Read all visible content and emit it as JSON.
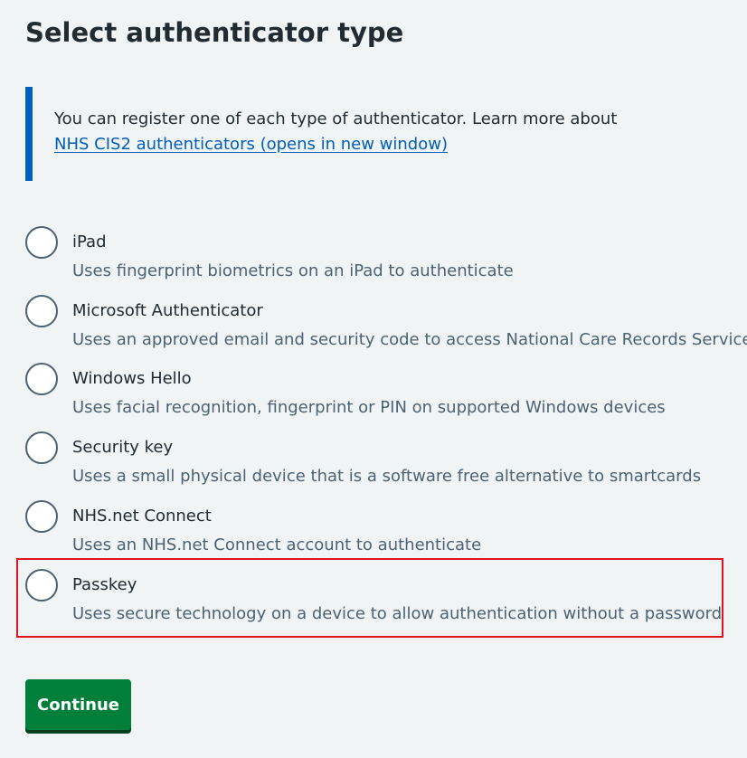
{
  "page": {
    "title": "Select authenticator type"
  },
  "inset": {
    "text": "You can register one of each type of authenticator. Learn more about",
    "link_text": "NHS CIS2 authenticators (opens in new window)"
  },
  "options": [
    {
      "label": "iPad",
      "hint": "Uses fingerprint biometrics on an iPad to authenticate"
    },
    {
      "label": "Microsoft Authenticator",
      "hint": "Uses an approved email and security code to access National Care Records Service"
    },
    {
      "label": "Windows Hello",
      "hint": "Uses facial recognition, fingerprint or PIN on supported Windows devices"
    },
    {
      "label": "Security key",
      "hint": "Uses a small physical device that is a software free alternative to smartcards"
    },
    {
      "label": "NHS.net Connect",
      "hint": "Uses an NHS.net Connect account to authenticate"
    },
    {
      "label": "Passkey",
      "hint": "Uses secure technology on a device to allow authentication without a password"
    }
  ],
  "actions": {
    "continue_label": "Continue"
  },
  "colors": {
    "background": "#f0f4f5",
    "inset_border": "#005eb8",
    "link": "#005eb8",
    "radio_border": "#4c6272",
    "hint_text": "#4c6272",
    "button": "#007f3b",
    "highlight_box": "#e0141e"
  }
}
